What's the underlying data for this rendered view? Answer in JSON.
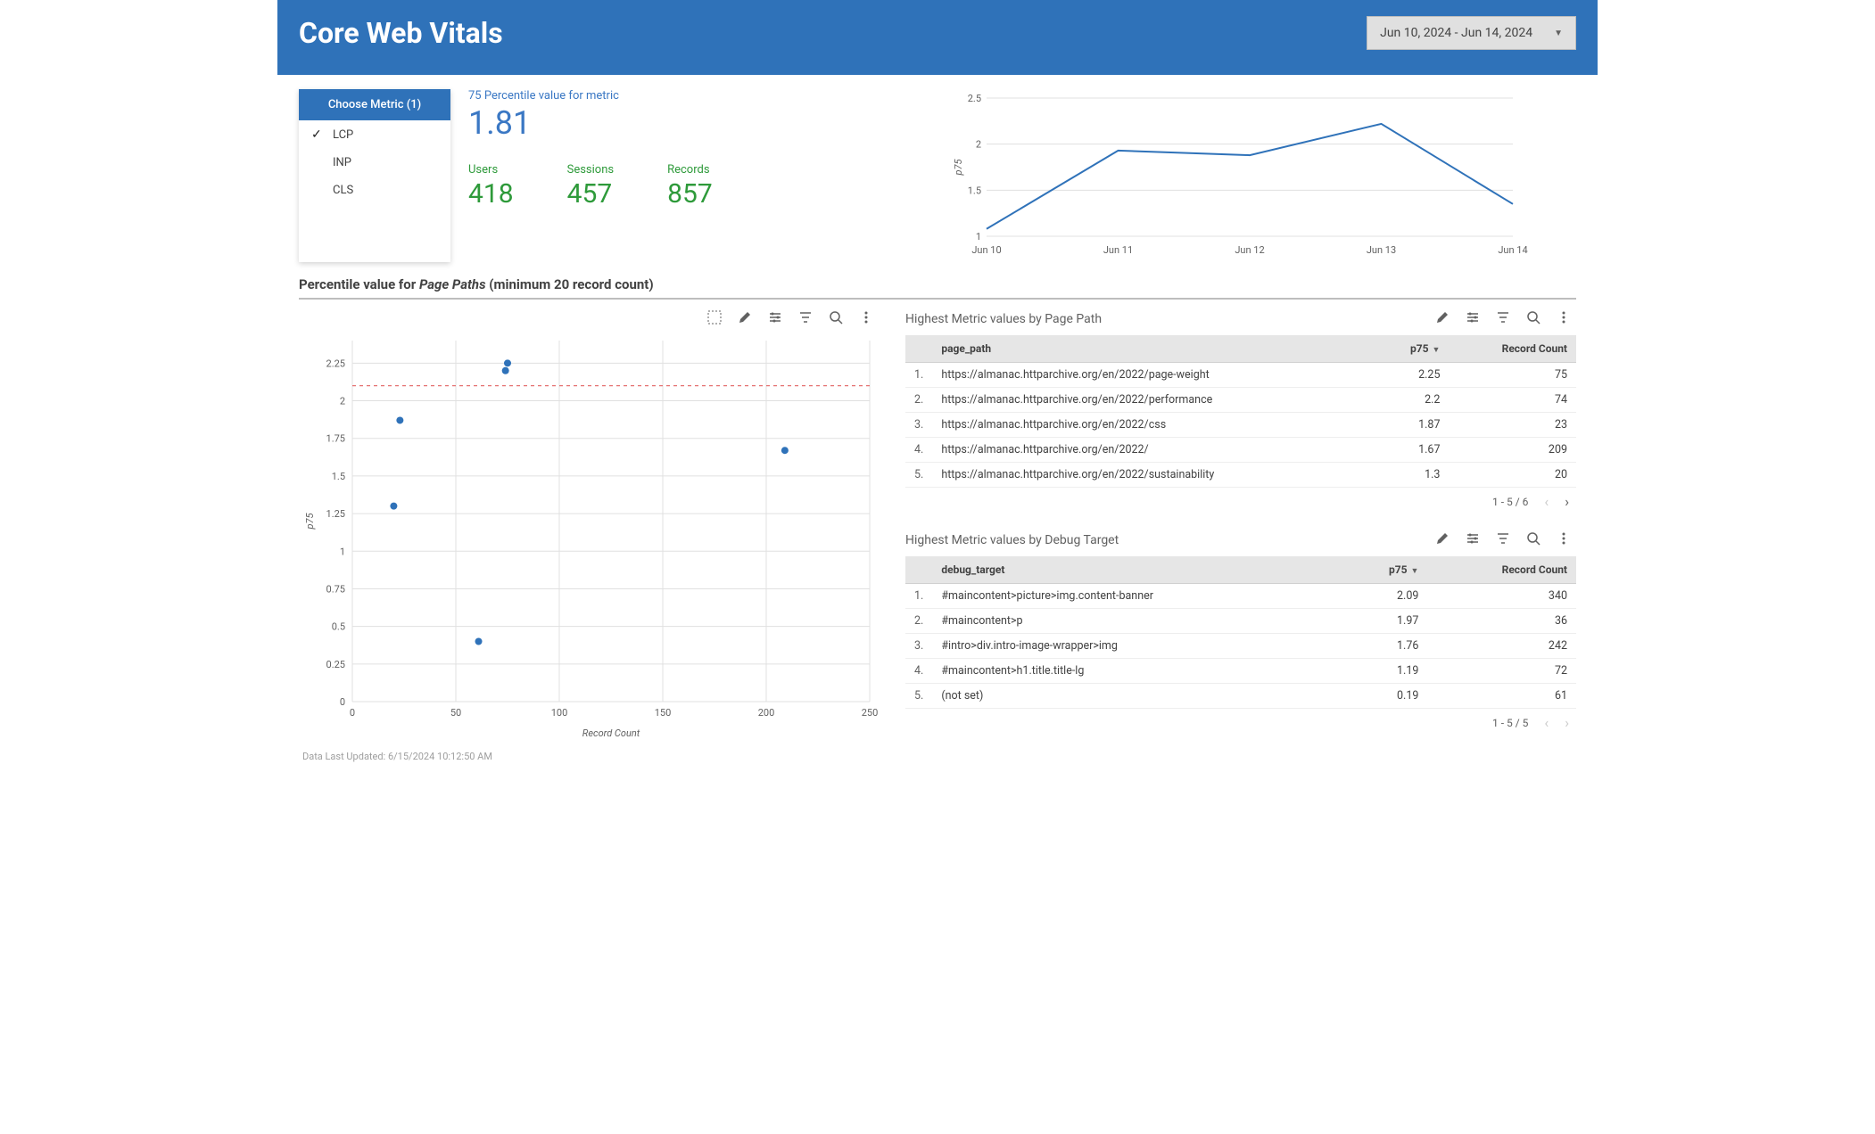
{
  "header": {
    "title": "Core Web Vitals",
    "date_range": "Jun 10, 2024 - Jun 14, 2024"
  },
  "metric_picker": {
    "header": "Choose Metric (1)",
    "options": [
      {
        "label": "LCP",
        "selected": true
      },
      {
        "label": "INP",
        "selected": false
      },
      {
        "label": "CLS",
        "selected": false
      }
    ]
  },
  "kpis": {
    "main_label": "75 Percentile value for metric",
    "main_value": "1.81",
    "items": [
      {
        "label": "Users",
        "value": "418"
      },
      {
        "label": "Sessions",
        "value": "457"
      },
      {
        "label": "Records",
        "value": "857"
      }
    ]
  },
  "section_title_prefix": "Percentile value for ",
  "section_title_em": "Page Paths",
  "section_title_suffix": " (minimum 20 record count)",
  "tables": {
    "page_path": {
      "title": "Highest Metric values by Page Path",
      "col_main": "page_path",
      "col_p75": "p75",
      "col_count": "Record Count",
      "rows": [
        {
          "idx": "1.",
          "path": "https://almanac.httparchive.org/en/2022/page-weight",
          "p75": "2.25",
          "count": "75"
        },
        {
          "idx": "2.",
          "path": "https://almanac.httparchive.org/en/2022/performance",
          "p75": "2.2",
          "count": "74"
        },
        {
          "idx": "3.",
          "path": "https://almanac.httparchive.org/en/2022/css",
          "p75": "1.87",
          "count": "23"
        },
        {
          "idx": "4.",
          "path": "https://almanac.httparchive.org/en/2022/",
          "p75": "1.67",
          "count": "209"
        },
        {
          "idx": "5.",
          "path": "https://almanac.httparchive.org/en/2022/sustainability",
          "p75": "1.3",
          "count": "20"
        }
      ],
      "pager": "1 - 5 / 6",
      "prev_disabled": true,
      "next_disabled": false
    },
    "debug_target": {
      "title": "Highest Metric values by Debug Target",
      "col_main": "debug_target",
      "col_p75": "p75",
      "col_count": "Record Count",
      "rows": [
        {
          "idx": "1.",
          "path": "#maincontent>picture>img.content-banner",
          "p75": "2.09",
          "count": "340"
        },
        {
          "idx": "2.",
          "path": "#maincontent>p",
          "p75": "1.97",
          "count": "36"
        },
        {
          "idx": "3.",
          "path": "#intro>div.intro-image-wrapper>img",
          "p75": "1.76",
          "count": "242"
        },
        {
          "idx": "4.",
          "path": "#maincontent>h1.title.title-lg",
          "p75": "1.19",
          "count": "72"
        },
        {
          "idx": "5.",
          "path": "(not set)",
          "p75": "0.19",
          "count": "61"
        }
      ],
      "pager": "1 - 5 / 5",
      "prev_disabled": true,
      "next_disabled": true
    }
  },
  "footer": "Data Last Updated: 6/15/2024 10:12:50 AM",
  "chart_data": [
    {
      "type": "line",
      "id": "p75-trend",
      "ylabel": "p75",
      "ylim": [
        1,
        2.5
      ],
      "yticks": [
        1,
        1.5,
        2,
        2.5
      ],
      "categories": [
        "Jun 10",
        "Jun 11",
        "Jun 12",
        "Jun 13",
        "Jun 14"
      ],
      "values": [
        1.08,
        1.93,
        1.88,
        2.22,
        1.35
      ]
    },
    {
      "type": "scatter",
      "id": "p75-vs-record-count",
      "xlabel": "Record Count",
      "ylabel": "p75",
      "xlim": [
        0,
        250
      ],
      "ylim": [
        0,
        2.4
      ],
      "xticks": [
        0,
        50,
        100,
        150,
        200,
        250
      ],
      "yticks": [
        0,
        0.25,
        0.5,
        0.75,
        1,
        1.25,
        1.5,
        1.75,
        2,
        2.25
      ],
      "reference_line_y": 2.1,
      "points": [
        {
          "x": 75,
          "y": 2.25
        },
        {
          "x": 74,
          "y": 2.2
        },
        {
          "x": 23,
          "y": 1.87
        },
        {
          "x": 209,
          "y": 1.67
        },
        {
          "x": 20,
          "y": 1.3
        },
        {
          "x": 61,
          "y": 0.4
        }
      ]
    }
  ]
}
